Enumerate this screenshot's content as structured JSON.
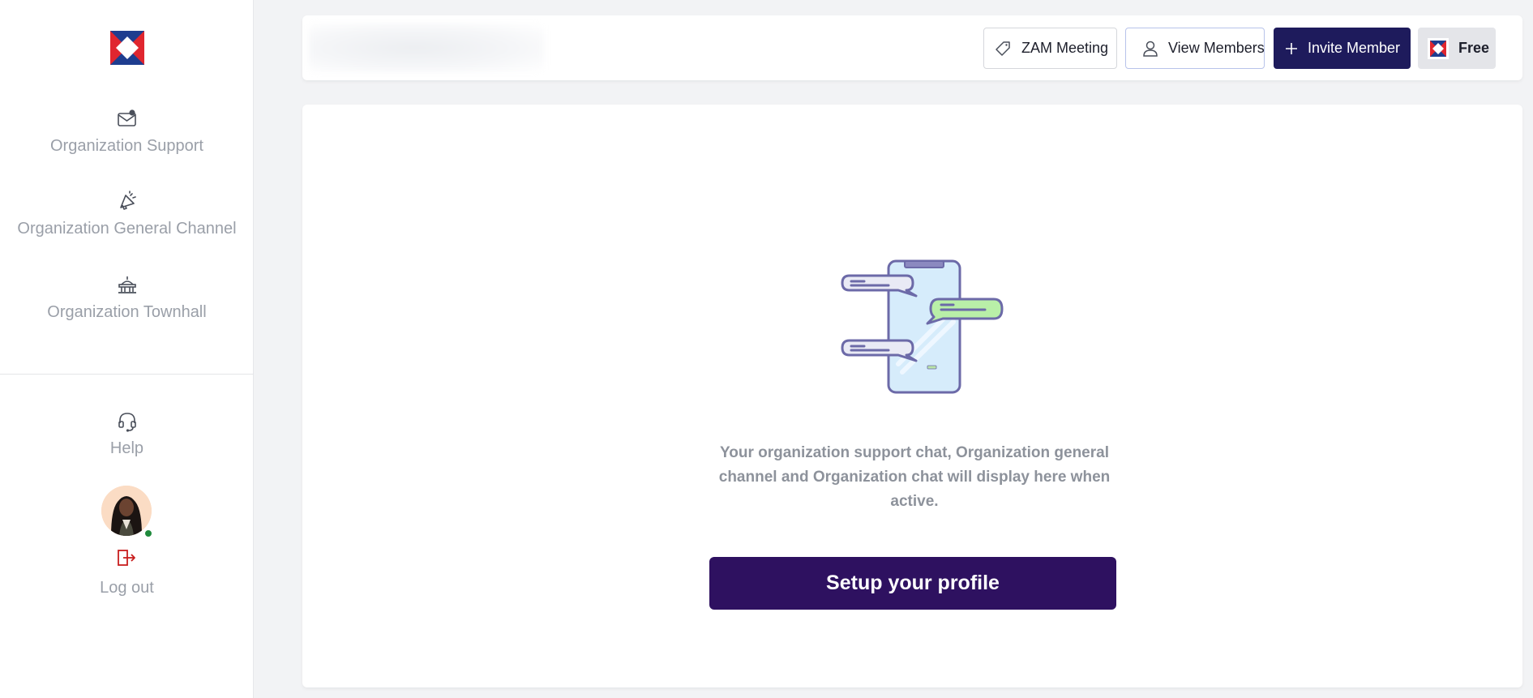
{
  "sidebar": {
    "items": [
      {
        "label": "Organization Support",
        "icon": "support-mail-icon"
      },
      {
        "label": "Organization General Channel",
        "icon": "megaphone-icon"
      },
      {
        "label": "Organization Townhall",
        "icon": "townhall-icon"
      }
    ],
    "help": {
      "label": "Help",
      "icon": "headset-icon"
    },
    "logout": {
      "label": "Log out",
      "icon": "logout-icon"
    }
  },
  "header": {
    "buttons": {
      "meeting": "ZAM Meeting",
      "members": "View Members",
      "invite": "Invite Member",
      "plan": "Free"
    }
  },
  "main": {
    "empty_message": "Your organization support chat, Organization general channel and Organization chat will display here when active.",
    "cta": "Setup your profile"
  },
  "colors": {
    "brand_dark": "#1e1b5c",
    "cta": "#2e1160",
    "logo_red": "#e0262f",
    "logo_blue": "#1e3d8f",
    "logout_red": "#c81e1e",
    "online": "#1f8a3c"
  }
}
